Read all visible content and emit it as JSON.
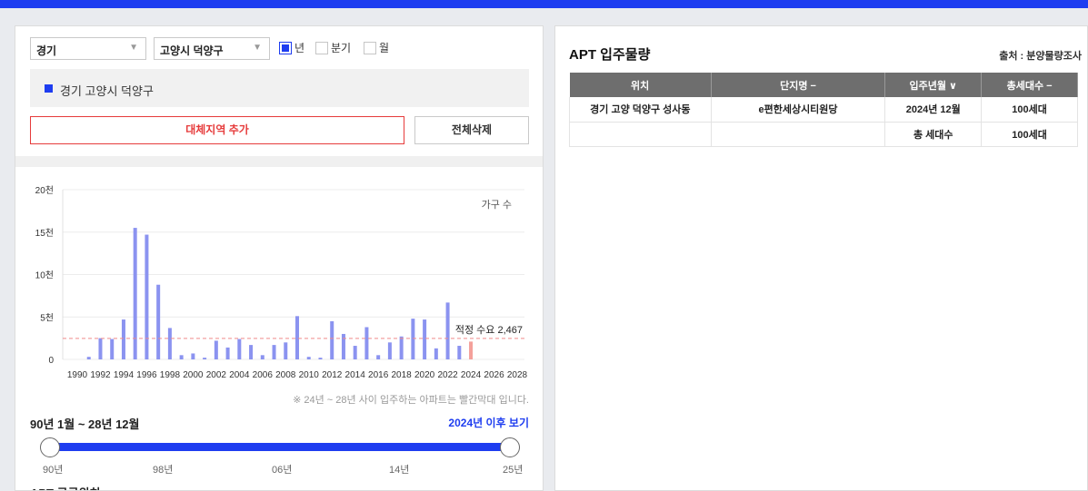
{
  "filters": {
    "province": "경기",
    "city": "고양시 덕양구",
    "period_options": [
      {
        "label": "년",
        "checked": true
      },
      {
        "label": "분기",
        "checked": false
      },
      {
        "label": "월",
        "checked": false
      }
    ]
  },
  "region_list": [
    "경기 고양시 덕양구"
  ],
  "buttons": {
    "add_region": "대체지역 추가",
    "delete_all": "전체삭제"
  },
  "chart_data": {
    "type": "bar",
    "unit_label": "가구 수",
    "y_tick_labels": [
      "0",
      "5천",
      "10천",
      "15천",
      "20천"
    ],
    "ylim": [
      0,
      20000
    ],
    "x_tick_labels": [
      "1990",
      "1992",
      "1994",
      "1996",
      "1998",
      "2000",
      "2002",
      "2004",
      "2006",
      "2008",
      "2010",
      "2012",
      "2014",
      "2016",
      "2018",
      "2020",
      "2022",
      "2024",
      "2026",
      "2028"
    ],
    "categories": [
      1990,
      1991,
      1992,
      1993,
      1994,
      1995,
      1996,
      1997,
      1998,
      1999,
      2000,
      2001,
      2002,
      2003,
      2004,
      2005,
      2006,
      2007,
      2008,
      2009,
      2010,
      2011,
      2012,
      2013,
      2014,
      2015,
      2016,
      2017,
      2018,
      2019,
      2020,
      2021,
      2022,
      2023,
      2024,
      2025,
      2026,
      2027,
      2028
    ],
    "values": [
      0,
      300,
      2500,
      2400,
      4700,
      15500,
      14700,
      8800,
      3700,
      500,
      700,
      200,
      2200,
      1400,
      2400,
      1700,
      500,
      1700,
      2000,
      5100,
      300,
      200,
      4500,
      3000,
      1600,
      3800,
      500,
      2000,
      2700,
      4800,
      4700,
      1300,
      6700,
      1600,
      2100,
      0,
      0,
      0,
      0
    ],
    "highlight_from": 2024,
    "colors": {
      "bar": "#8b93f0",
      "highlight": "#f4a09a",
      "reference": "#f08a8a"
    },
    "reference": {
      "label": "적정 수요 2,467",
      "value": 2467
    },
    "grid": true
  },
  "chart_note": "※ 24년 ~ 28년 사이 입주하는 아파트는 빨간막대 입니다.",
  "range": {
    "label": "90년 1월 ~ 28년 12월",
    "after_link": "2024년 이후 보기",
    "ticks": [
      "90년",
      "98년",
      "06년",
      "14년",
      "25년"
    ]
  },
  "bottom_title": "APT 공급위치",
  "apt_panel": {
    "title": "APT 입주물량",
    "source": "출처 : 분양물량조사",
    "columns": [
      "위치",
      "단지명 −",
      "입주년월 ∨",
      "총세대수 −"
    ],
    "rows": [
      [
        "경기 고양 덕양구 성사동",
        "e편한세상시티원당",
        "2024년 12월",
        "100세대"
      ],
      [
        "",
        "",
        "총 세대수",
        "100세대"
      ]
    ]
  }
}
